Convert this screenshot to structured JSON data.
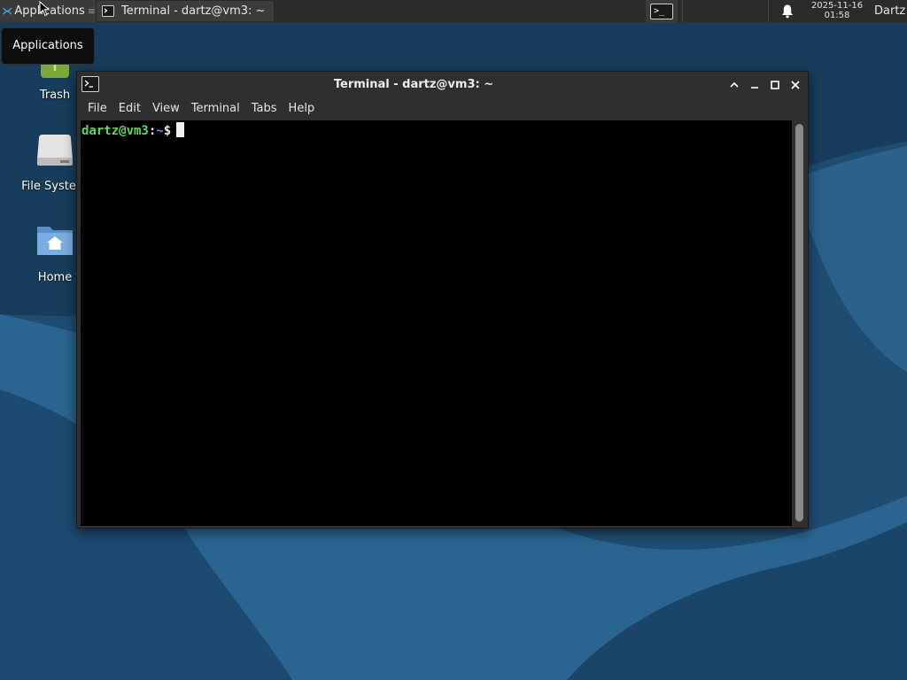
{
  "panel": {
    "applications_label": "Applications",
    "applications_separator": "≡",
    "taskbar_item_label": "Terminal - dartz@vm3: ~",
    "clock_date": "2025-11-16",
    "clock_time": "01:58",
    "user_label": "Dartz"
  },
  "tooltip": {
    "text": "Applications"
  },
  "desktop": {
    "icons": [
      {
        "label": "Trash",
        "icon": "trash-icon"
      },
      {
        "label": "File Syste",
        "icon": "drive-icon"
      },
      {
        "label": "Home",
        "icon": "home-folder-icon"
      }
    ]
  },
  "window": {
    "title": "Terminal - dartz@vm3: ~",
    "menu": [
      "File",
      "Edit",
      "View",
      "Terminal",
      "Tabs",
      "Help"
    ],
    "terminal": {
      "prompt_user_host": "dartz@vm3",
      "prompt_separator": ":",
      "prompt_path": "~",
      "prompt_symbol": "$"
    }
  },
  "colors": {
    "panel_bg": "#2b2b2b",
    "window_bg": "#2f2f2f",
    "terminal_bg": "#000000",
    "prompt_user": "#5fd75f",
    "prompt_path": "#6a9ae8",
    "desktop_bg": "#1d4a6e"
  }
}
